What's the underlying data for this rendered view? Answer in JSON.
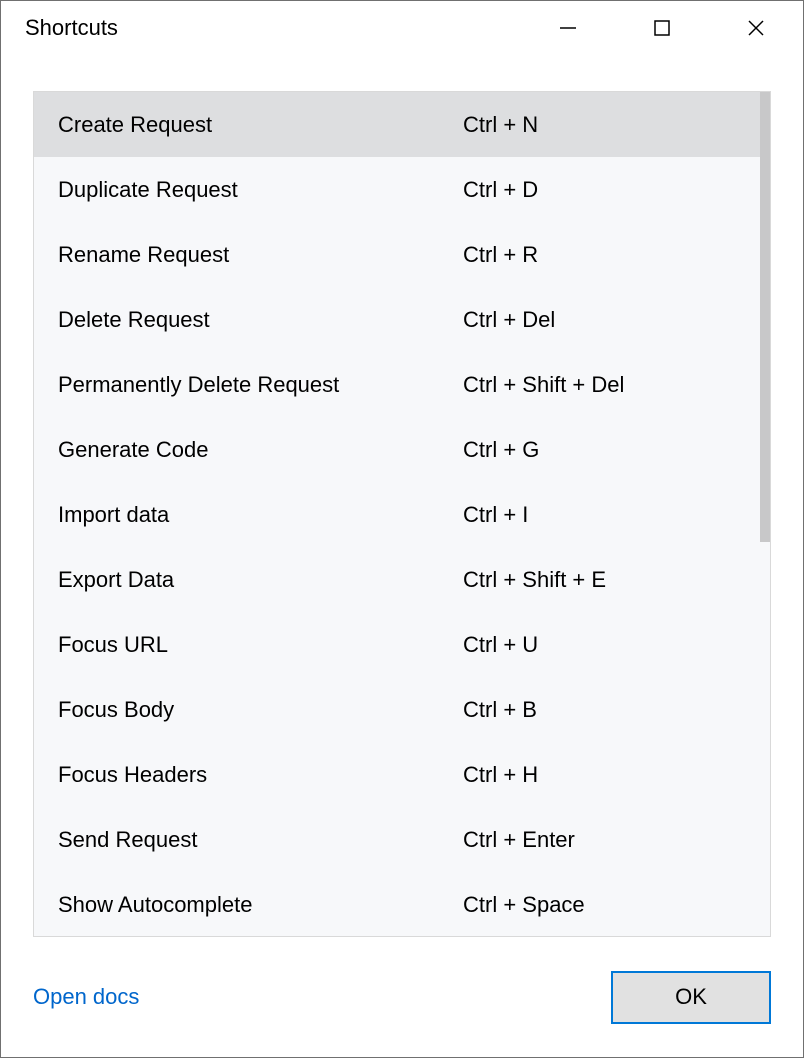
{
  "window": {
    "title": "Shortcuts"
  },
  "shortcuts": [
    {
      "label": "Create Request",
      "keys": "Ctrl + N",
      "selected": true
    },
    {
      "label": "Duplicate Request",
      "keys": "Ctrl + D",
      "selected": false
    },
    {
      "label": "Rename Request",
      "keys": "Ctrl + R",
      "selected": false
    },
    {
      "label": "Delete Request",
      "keys": "Ctrl + Del",
      "selected": false
    },
    {
      "label": "Permanently Delete Request",
      "keys": "Ctrl + Shift + Del",
      "selected": false
    },
    {
      "label": "Generate Code",
      "keys": "Ctrl + G",
      "selected": false
    },
    {
      "label": "Import data",
      "keys": "Ctrl + I",
      "selected": false
    },
    {
      "label": "Export Data",
      "keys": "Ctrl + Shift + E",
      "selected": false
    },
    {
      "label": "Focus URL",
      "keys": "Ctrl + U",
      "selected": false
    },
    {
      "label": "Focus Body",
      "keys": "Ctrl + B",
      "selected": false
    },
    {
      "label": "Focus Headers",
      "keys": "Ctrl + H",
      "selected": false
    },
    {
      "label": "Send Request",
      "keys": "Ctrl + Enter",
      "selected": false
    },
    {
      "label": "Show Autocomplete",
      "keys": "Ctrl + Space",
      "selected": false
    }
  ],
  "footer": {
    "docs_link": "Open docs",
    "ok_button": "OK"
  }
}
